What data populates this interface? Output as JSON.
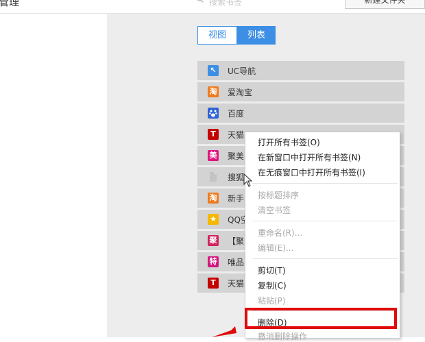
{
  "header": {
    "title_fragment": "管理",
    "search_placeholder": "搜索书签",
    "new_folder_label": "新建文件夹"
  },
  "view_toggle": {
    "view_label": "视图",
    "list_label": "列表",
    "active": "列表"
  },
  "bookmarks": [
    {
      "label": "UC导航",
      "icon": "cursor-arrow-icon",
      "icon_char": "↖",
      "icon_color": "#3d8fe5"
    },
    {
      "label": "爱淘宝",
      "icon": "taobao-icon",
      "icon_char": "淘",
      "icon_color": "#f07b1e"
    },
    {
      "label": "百度",
      "icon": "baidu-paw-icon",
      "icon_char": "🐾",
      "icon_color": "#2f63d6"
    },
    {
      "label": "天猫",
      "icon": "tmall-icon",
      "icon_char": "T",
      "icon_color": "#c40000"
    },
    {
      "label": "聚美",
      "icon": "jumei-icon",
      "icon_char": "美",
      "icon_color": "#e0177f"
    },
    {
      "label": "搜狐",
      "icon": "document-icon",
      "icon_char": "",
      "icon_color": "#b8b8b8"
    },
    {
      "label": "新手",
      "icon": "taobao-icon",
      "icon_char": "淘",
      "icon_color": "#f07b1e"
    },
    {
      "label": "QQ空",
      "icon": "qzone-star-icon",
      "icon_char": "★",
      "icon_color": "#f5b800"
    },
    {
      "label": "【聚",
      "icon": "ju-icon",
      "icon_char": "聚",
      "icon_color": "#d2245c"
    },
    {
      "label": "唯品",
      "icon": "vip-icon",
      "icon_char": "特",
      "icon_color": "#d4177e"
    },
    {
      "label": "天猫",
      "icon": "tmall-icon",
      "icon_char": "T",
      "icon_color": "#c40000"
    }
  ],
  "context_menu": {
    "items": [
      {
        "label": "打开所有书签(O)",
        "enabled": true
      },
      {
        "label": "在新窗口中打开所有书签(N)",
        "enabled": true
      },
      {
        "label": "在无痕窗口中打开所有书签(I)",
        "enabled": true
      },
      {
        "label": "按标题排序",
        "enabled": false
      },
      {
        "label": "清空书签",
        "enabled": false
      },
      {
        "label": "重命名(R)...",
        "enabled": false
      },
      {
        "label": "编辑(E)...",
        "enabled": false
      },
      {
        "label": "剪切(T)",
        "enabled": true
      },
      {
        "label": "复制(C)",
        "enabled": true
      },
      {
        "label": "粘贴(P)",
        "enabled": false
      },
      {
        "label": "删除(D)",
        "enabled": true
      },
      {
        "label": "撤消删除操作",
        "enabled": false
      }
    ],
    "highlighted": "删除(D)",
    "highlight_color": "#e00b0b"
  },
  "colors": {
    "accent": "#3d8fe5",
    "main_bg": "#ededed",
    "item_bg": "#d3d3d3"
  }
}
